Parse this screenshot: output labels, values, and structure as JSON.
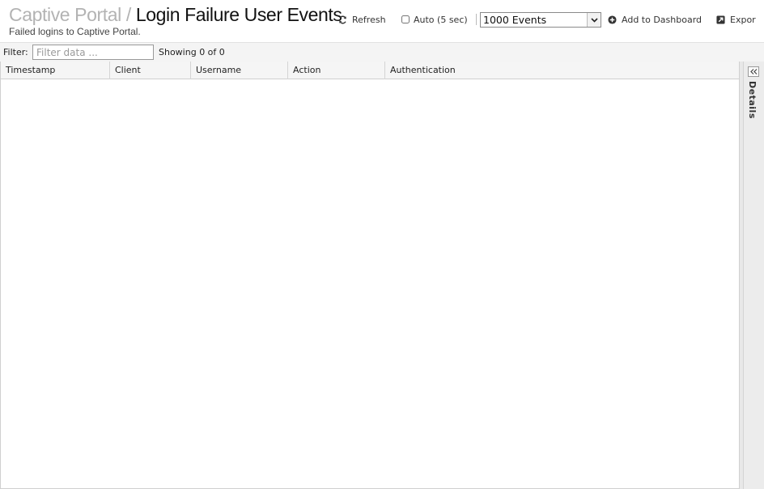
{
  "header": {
    "breadcrumb_parent": "Captive Portal",
    "breadcrumb_separator": "/",
    "title": "Login Failure User Events",
    "subtitle": "Failed logins to Captive Portal."
  },
  "toolbar": {
    "refresh_label": "Refresh",
    "auto_label": "Auto (5 sec)",
    "auto_checked": false,
    "events_selected": "1000 Events",
    "add_dashboard_label": "Add to Dashboard",
    "export_label": "Expor"
  },
  "filter": {
    "label": "Filter:",
    "placeholder": "Filter data ...",
    "value": "",
    "showing_text": "Showing 0 of 0"
  },
  "grid": {
    "columns": [
      "Timestamp",
      "Client",
      "Username",
      "Action",
      "Authentication"
    ],
    "rows": []
  },
  "details_panel": {
    "label": "Details"
  },
  "icons": {
    "refresh": "refresh-icon",
    "add": "plus-circle-icon",
    "export": "export-icon",
    "collapse": "double-chevron-left-icon",
    "dropdown": "chevron-down-icon"
  }
}
